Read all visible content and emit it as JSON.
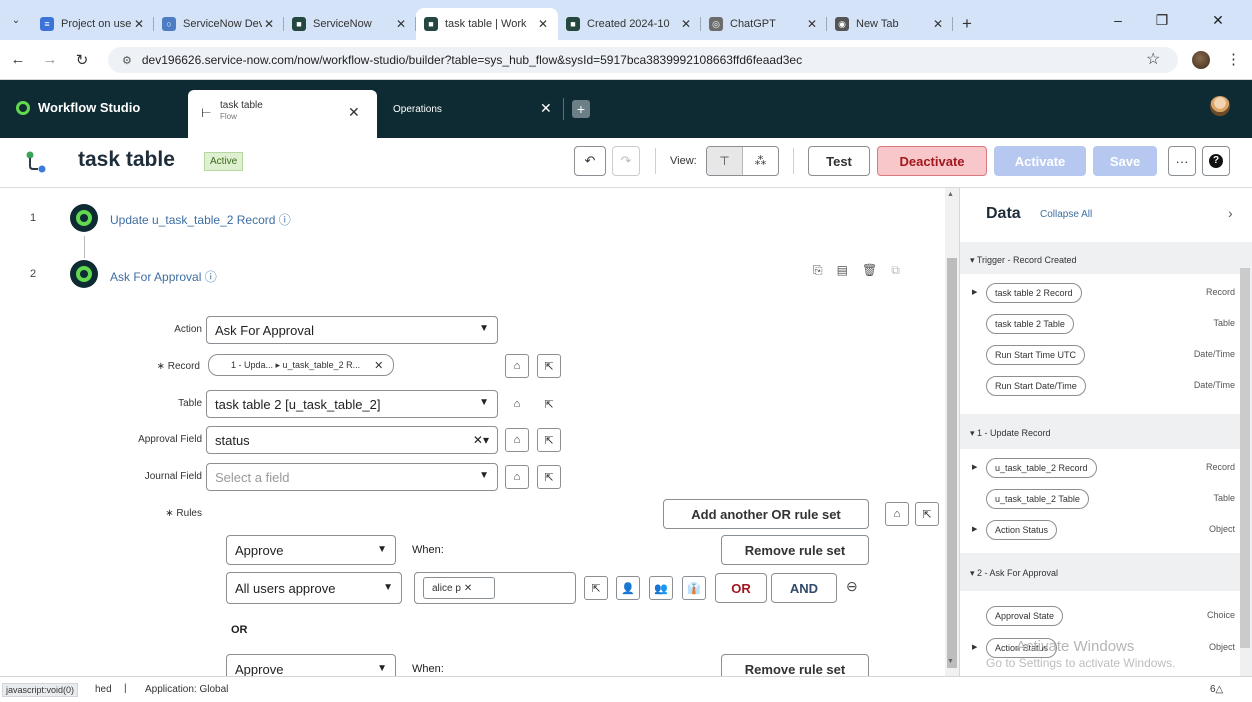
{
  "browser": {
    "tabs": [
      {
        "label": "Project on user.c",
        "fav_color": "#3b73d9",
        "fav_glyph": "≡"
      },
      {
        "label": "ServiceNow Dev",
        "fav_color": "#4d7cc4",
        "fav_glyph": "○"
      },
      {
        "label": "ServiceNow",
        "fav_color": "#24473f",
        "fav_glyph": "■"
      },
      {
        "label": "task table | Work",
        "fav_color": "#24473f",
        "fav_glyph": "■",
        "active": true
      },
      {
        "label": "Created 2024-10",
        "fav_color": "#24473f",
        "fav_glyph": "■"
      },
      {
        "label": "ChatGPT",
        "fav_color": "#6c6c6c",
        "fav_glyph": "◎"
      },
      {
        "label": "New Tab",
        "fav_color": "#555555",
        "fav_glyph": "◉"
      }
    ],
    "url": "dev196626.service-now.com/now/workflow-studio/builder?table=sys_hub_flow&sysId=5917bca3839992108663ffd6feaad3ec"
  },
  "studio": {
    "app_name": "Workflow Studio",
    "tab1_name": "task table",
    "tab1_sub": "Flow",
    "tab2_name": "Operations"
  },
  "flow": {
    "title": "task table",
    "status": "Active",
    "view_label": "View:",
    "test_label": "Test",
    "deactivate_label": "Deactivate",
    "activate_label": "Activate",
    "save_label": "Save",
    "more_label": "···",
    "help_label": "?"
  },
  "steps": [
    {
      "num": "1",
      "title": "Update u_task_table_2 Record  ⓘ"
    },
    {
      "num": "2",
      "title": "Ask For Approval  ⓘ"
    }
  ],
  "form": {
    "action_label": "Action",
    "action_value": "Ask For Approval",
    "record_label": "∗ Record",
    "record_value": "1 - Upda...  ▸ u_task_table_2 R...",
    "table_label": "Table",
    "table_value": "task table 2 [u_task_table_2]",
    "approval_field_label": "Approval Field",
    "approval_field_value": "status",
    "journal_field_label": "Journal Field",
    "journal_field_placeholder": "Select a field",
    "rules_label": "∗ Rules",
    "add_rule_set": "Add another OR rule set",
    "remove_rule_set": "Remove rule set",
    "rule_action": "Approve",
    "when_label": "When:",
    "rule_condition": "All users approve",
    "user_chip": "alice p",
    "or_button": "OR",
    "and_button": "AND",
    "or_separator": "OR",
    "rule2_action": "Approve",
    "rule2_when": "When:",
    "remove_rule_set_2": "Remove rule set"
  },
  "data_panel": {
    "title": "Data",
    "collapse_all": "Collapse All",
    "sections": [
      {
        "label": "▾ Trigger - Record Created",
        "items": [
          {
            "label": "task table 2 Record",
            "type": "Record",
            "expand": true
          },
          {
            "label": "task table 2 Table",
            "type": "Table",
            "expand": false
          },
          {
            "label": "Run Start Time UTC",
            "type": "Date/Time",
            "expand": false
          },
          {
            "label": "Run Start Date/Time",
            "type": "Date/Time",
            "expand": false
          }
        ]
      },
      {
        "label": "▾ 1 - Update Record",
        "items": [
          {
            "label": "u_task_table_2 Record",
            "type": "Record",
            "expand": true
          },
          {
            "label": "u_task_table_2 Table",
            "type": "Table",
            "expand": false
          },
          {
            "label": "Action Status",
            "type": "Object",
            "expand": true
          }
        ]
      },
      {
        "label": "▾ 2 - Ask For Approval",
        "items": [
          {
            "label": "Approval State",
            "type": "Choice",
            "expand": false
          },
          {
            "label": "Action Status",
            "type": "Object",
            "expand": true
          }
        ]
      }
    ]
  },
  "watermark": {
    "line1": "Activate Windows",
    "line2": "Go to Settings to activate Windows."
  },
  "status_bar": {
    "link": "javascript:void(0)",
    "partial": "hed",
    "divider": "|",
    "application": "Application: Global",
    "right": "6△"
  }
}
